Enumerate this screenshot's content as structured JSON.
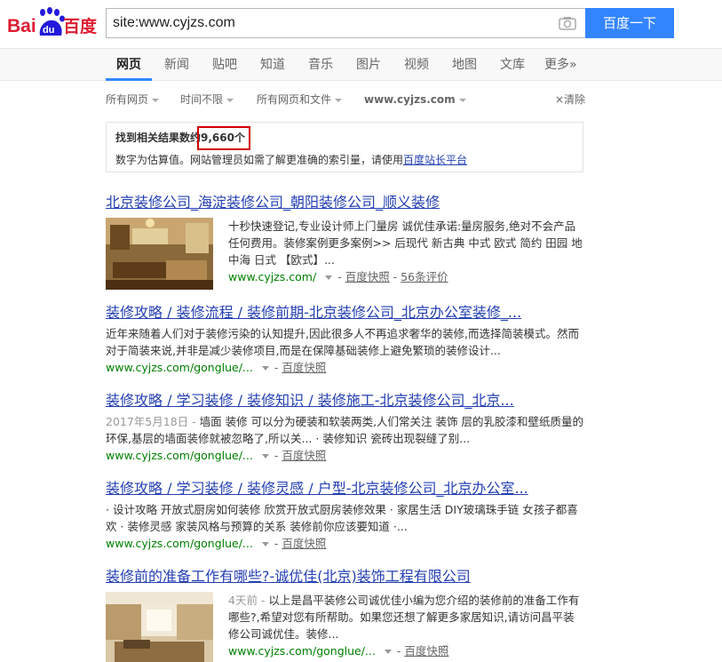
{
  "header": {
    "search_value": "site:www.cyjzs.com",
    "search_button": "百度一下",
    "logo_left": "Bai",
    "logo_mid": "du",
    "logo_right": "百度"
  },
  "nav": {
    "items": [
      "网页",
      "新闻",
      "贴吧",
      "知道",
      "音乐",
      "图片",
      "视频",
      "地图",
      "文库",
      "更多»"
    ]
  },
  "filters": {
    "items": [
      "所有网页",
      "时间不限",
      "所有网页和文件",
      "www.cyjzs.com"
    ],
    "clear": "×清除"
  },
  "count": {
    "label": "找到相关结果数约",
    "value": "9,660个",
    "note": "数字为估算值。网站管理员如需了解更准确的索引量，请使用",
    "link": "百度站长平台"
  },
  "results": [
    {
      "title": "北京装修公司_海淀装修公司_朝阳装修公司_顺义装修",
      "abstract": "十秒快速登记,专业设计师上门量房 诚优佳承诺:量房服务,绝对不会产品任何费用。装修案例更多案例>> 后现代 新古典 中式 欧式 简约 田园 地中海 日式 【欧式】...",
      "url": "www.cyjzs.com/",
      "snapshot": "百度快照",
      "reviews": "56条评价"
    },
    {
      "title": "装修攻略 / 装修流程 / 装修前期-北京装修公司_北京办公室装修_...",
      "abstract": "近年来随着人们对于装修污染的认知提升,因此很多人不再追求奢华的装修,而选择简装模式。然而对于简装来说,并非是减少装修项目,而是在保障基础装修上避免繁琐的装修设计...",
      "url": "www.cyjzs.com/gonglue/...",
      "snapshot": "百度快照"
    },
    {
      "title": "装修攻略 / 学习装修 / 装修知识 / 装修施工-北京装修公司_北京...",
      "date": "2017年5月18日 - ",
      "abstract": "墙面 装修 可以分为硬装和软装两类,人们常关注 装饰 层的乳胶漆和壁纸质量的环保,基层的墙面装修就被忽略了,所以关... · 装修知识 瓷砖出现裂缝了别...",
      "url": "www.cyjzs.com/gonglue/...",
      "snapshot": "百度快照"
    },
    {
      "title": "装修攻略 / 学习装修 / 装修灵感 / 户型-北京装修公司_北京办公室...",
      "abstract": "· 设计攻略 开放式厨房如何装修 欣赏开放式厨房装修效果 · 家居生活 DIY玻璃珠手链 女孩子都喜欢 · 装修灵感 家装风格与预算的关系 装修前你应该要知道 ·...",
      "url": "www.cyjzs.com/gonglue/...",
      "snapshot": "百度快照"
    },
    {
      "title": "装修前的准备工作有哪些?-诚优佳(北京)装饰工程有限公司",
      "date": "4天前 - ",
      "abstract": "以上是昌平装修公司诚优佳小编为您介绍的装修前的准备工作有哪些?,希望对您有所帮助。如果您还想了解更多家居知识,请访问昌平装修公司诚优佳。装修...",
      "url": "www.cyjzs.com/gonglue/...",
      "snapshot": "百度快照"
    }
  ],
  "colors": {
    "brand_red": "#de1c31",
    "brand_blue": "#2319dc",
    "link": "#2440b3",
    "url_green": "#008000",
    "button": "#3385ff"
  }
}
